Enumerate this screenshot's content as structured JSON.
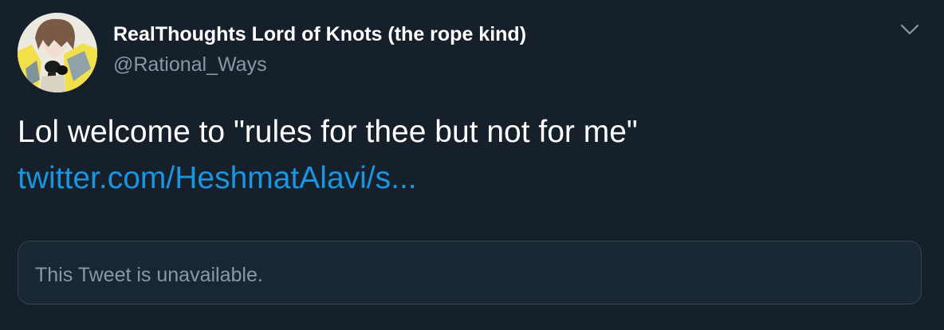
{
  "author": {
    "display_name": "RealThoughts Lord of Knots (the rope kind)",
    "handle": "@Rational_Ways",
    "avatar_icon": "anime-avatar-icon"
  },
  "menu": {
    "icon": "chevron-down-icon"
  },
  "tweet": {
    "text": "Lol welcome to \"rules for thee but not for me\"",
    "link_text": "twitter.com/HeshmatAlavi/s..."
  },
  "quoted_tweet": {
    "text": "This Tweet is unavailable."
  },
  "colors": {
    "background": "#15202b",
    "link": "#1b95e0",
    "secondary_text": "#8899a6",
    "card_border": "#38444d"
  }
}
